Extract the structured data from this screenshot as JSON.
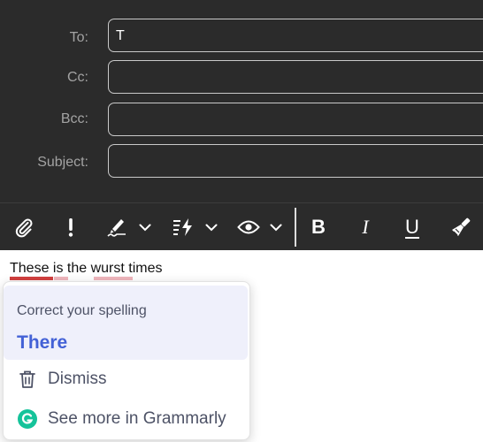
{
  "compose": {
    "to_label": "To:",
    "to_value": "T",
    "cc_label": "Cc:",
    "cc_value": "",
    "bcc_label": "Bcc:",
    "bcc_value": "",
    "subject_label": "Subject:",
    "subject_value": ""
  },
  "toolbar": {
    "bold_label": "B",
    "italic_label": "I",
    "underline_label": "U"
  },
  "body": {
    "misspelled_word": "These",
    "rest_text": " is the wurst times"
  },
  "grammarly": {
    "title": "Correct your spelling",
    "suggestion": "There",
    "dismiss_label": "Dismiss",
    "more_label": "See more in Grammarly",
    "brand_color": "#15c39a",
    "accent_color": "#4361d6",
    "error_color": "#d2403f"
  }
}
